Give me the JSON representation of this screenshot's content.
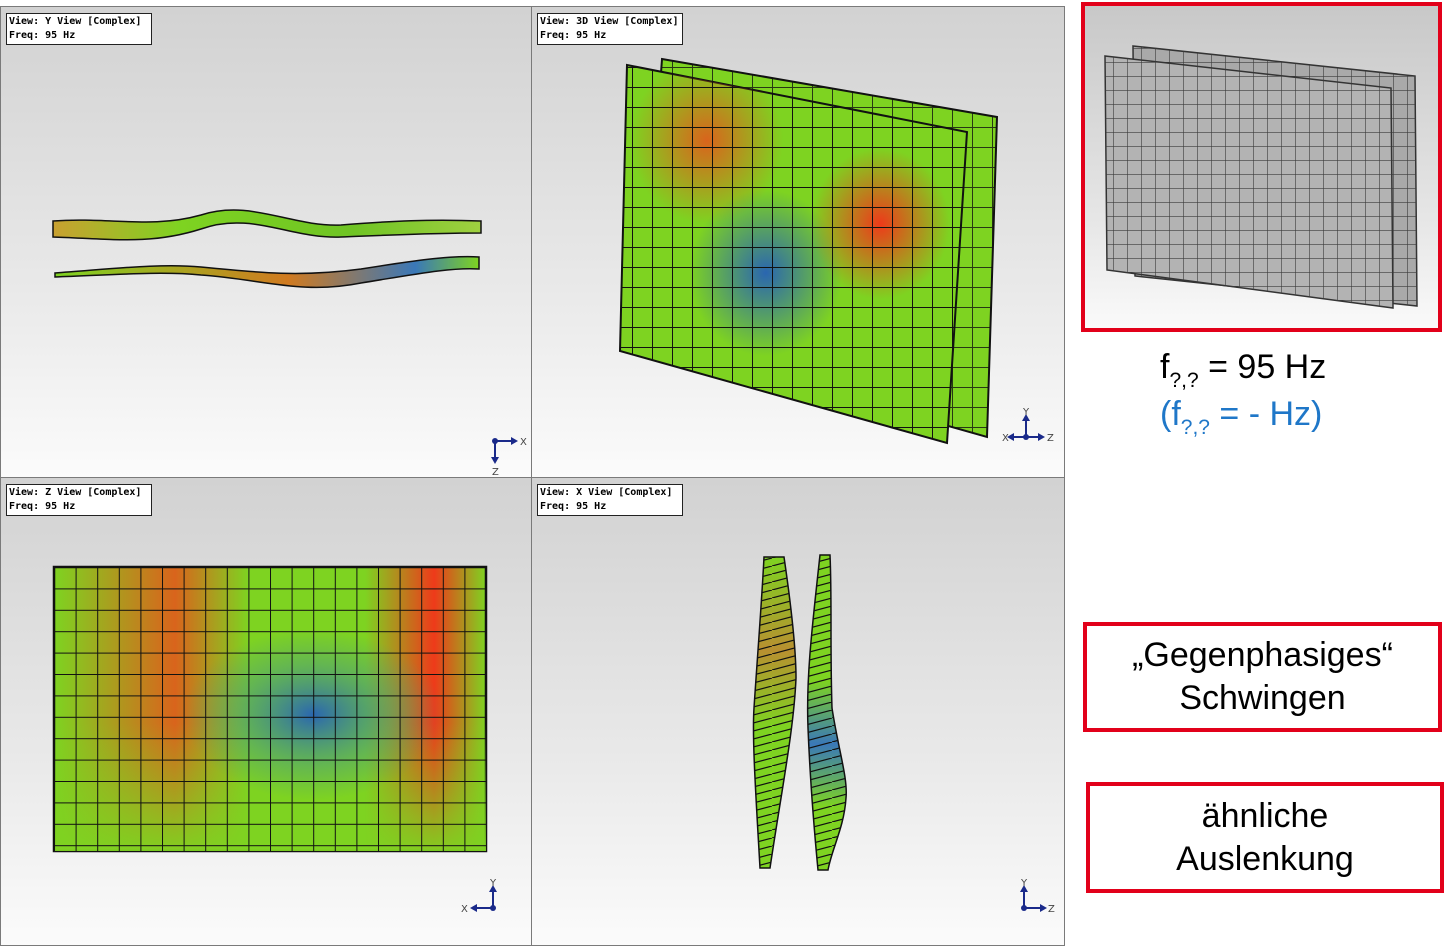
{
  "viewports": [
    {
      "title": "View: Y View [Complex]",
      "freq": "Freq: 95 Hz"
    },
    {
      "title": "View: 3D View [Complex]",
      "freq": "Freq: 95 Hz"
    },
    {
      "title": "View: Z View [Complex]",
      "freq": "Freq: 95 Hz"
    },
    {
      "title": "View: X View [Complex]",
      "freq": "Freq: 95 Hz"
    }
  ],
  "axes": {
    "y_view": {
      "h": "X",
      "v": "Z"
    },
    "view_3d": {
      "v": "Y",
      "left": "X",
      "right": "Z"
    },
    "z_view": {
      "v": "Y",
      "h": "X"
    },
    "x_view": {
      "v": "Y",
      "h": "Z"
    }
  },
  "frequency": {
    "main_prefix": "f",
    "main_sub": "?,?",
    "main_rest": " = 95 Hz",
    "alt_open": "(f",
    "alt_sub": "?,?",
    "alt_rest": " = - Hz)"
  },
  "notes": {
    "note1_line1": "„Gegenphasiges“",
    "note1_line2": "Schwingen",
    "note2_line1": "ähnliche",
    "note2_line2": "Auslenkung"
  },
  "colors": {
    "accent_red": "#e2001a",
    "alt_blue": "#1f77c8",
    "mesh_green": "#7ed321",
    "mesh_orange": "#d9641c",
    "mesh_red": "#ee3a1a",
    "mesh_blue": "#2a66b0"
  }
}
